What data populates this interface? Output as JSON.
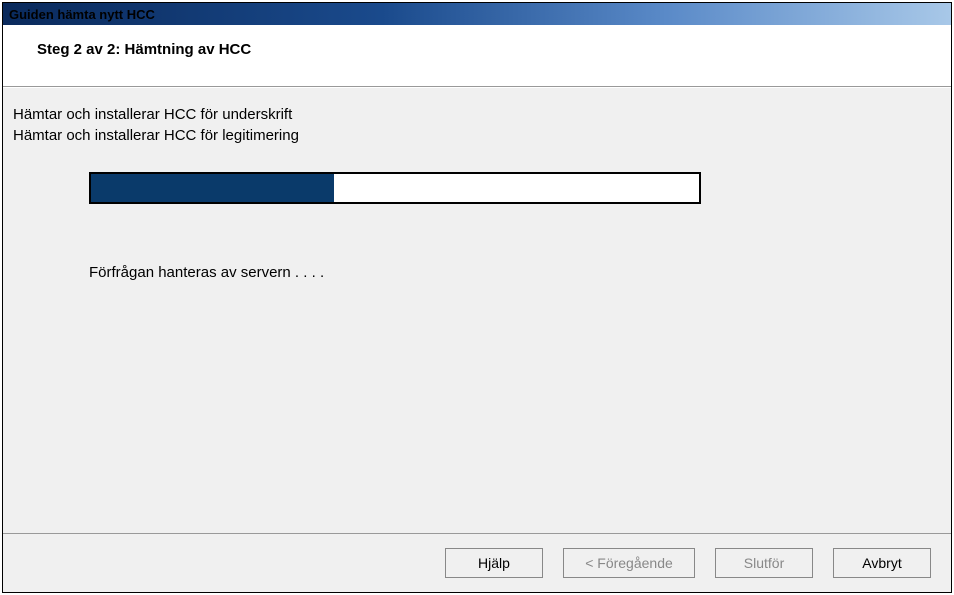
{
  "window": {
    "title": "Guiden hämta nytt HCC"
  },
  "header": {
    "step_title": "Steg 2 av 2: Hämtning av HCC"
  },
  "content": {
    "status_lines": [
      "Hämtar och installerar HCC för underskrift",
      "Hämtar och installerar HCC för legitimering"
    ],
    "progress_percent": 40,
    "server_message": "Förfrågan hanteras av servern . . . ."
  },
  "buttons": {
    "help": "Hjälp",
    "previous": "< Föregående",
    "finish": "Slutför",
    "cancel": "Avbryt"
  }
}
